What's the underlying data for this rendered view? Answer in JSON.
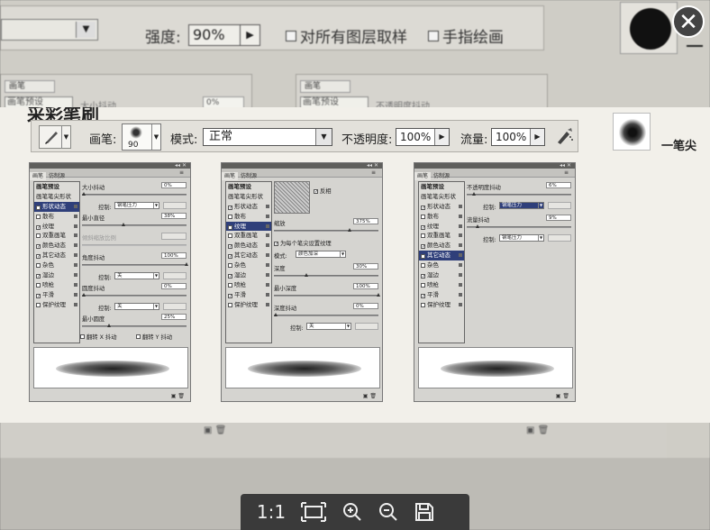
{
  "background": {
    "strength_label": "强度:",
    "strength_value": "90%",
    "sample_all_layers_label": "对所有图层取样",
    "finger_paint_label": "手指绘画",
    "panel_tab": "画笔",
    "panel_row_label": "画笔预设",
    "panel_left_text": "大小抖动",
    "panel_right_text": "不透明度抖动",
    "panel_pct": "0%"
  },
  "card": {
    "heading": "采彩笔刷",
    "heading_right": "一笔尖"
  },
  "optbar": {
    "brush_label": "画笔:",
    "brush_size": "90",
    "mode_label": "模式:",
    "mode_value": "正常",
    "opacity_label": "不透明度:",
    "opacity_value": "100%",
    "flow_label": "流量:",
    "flow_value": "100%"
  },
  "panels": {
    "tab_brush": "画笔",
    "tab_presets": "仿制源",
    "list_items": [
      "画笔预设",
      "画笔笔尖形状",
      "形状动态",
      "散布",
      "纹理",
      "双重画笔",
      "颜色动态",
      "其它动态",
      "杂色",
      "湿边",
      "喷枪",
      "平滑",
      "保护纹理"
    ],
    "p1": {
      "size_jitter": "大小抖动",
      "size_jitter_val": "0%",
      "control_label": "控制:",
      "control_val": "钢笔压力",
      "min_diameter": "最小直径",
      "min_diameter_val": "38%",
      "tilt_scale": "倾斜缩放比例",
      "angle_jitter": "角度抖动",
      "angle_jitter_val": "100%",
      "control2_val": "关",
      "roundness_jitter": "圆度抖动",
      "roundness_jitter_val": "0%",
      "control3_val": "关",
      "min_roundness": "最小圆度",
      "min_roundness_val": "25%",
      "flip_x": "翻转 X 抖动",
      "flip_y": "翻转 Y 抖动"
    },
    "p2": {
      "invert": "反相",
      "scale": "缩放",
      "scale_val": "375%",
      "texture_each": "为每个笔尖设置纹理",
      "mode_label": "模式:",
      "mode_val": "颜色加深",
      "depth": "深度",
      "depth_val": "30%",
      "min_depth": "最小深度",
      "min_depth_val": "100%",
      "depth_jitter": "深度抖动",
      "depth_jitter_val": "0%",
      "control_label": "控制:",
      "control_val": "关"
    },
    "p3": {
      "opacity_jitter": "不透明度抖动",
      "opacity_jitter_val": "6%",
      "control_label": "控制:",
      "control_val": "钢笔压力",
      "flow_jitter": "流量抖动",
      "flow_jitter_val": "9%",
      "control2_val": "钢笔压力"
    }
  },
  "viewer": {
    "actual_size": "1:1",
    "close": "✕"
  }
}
